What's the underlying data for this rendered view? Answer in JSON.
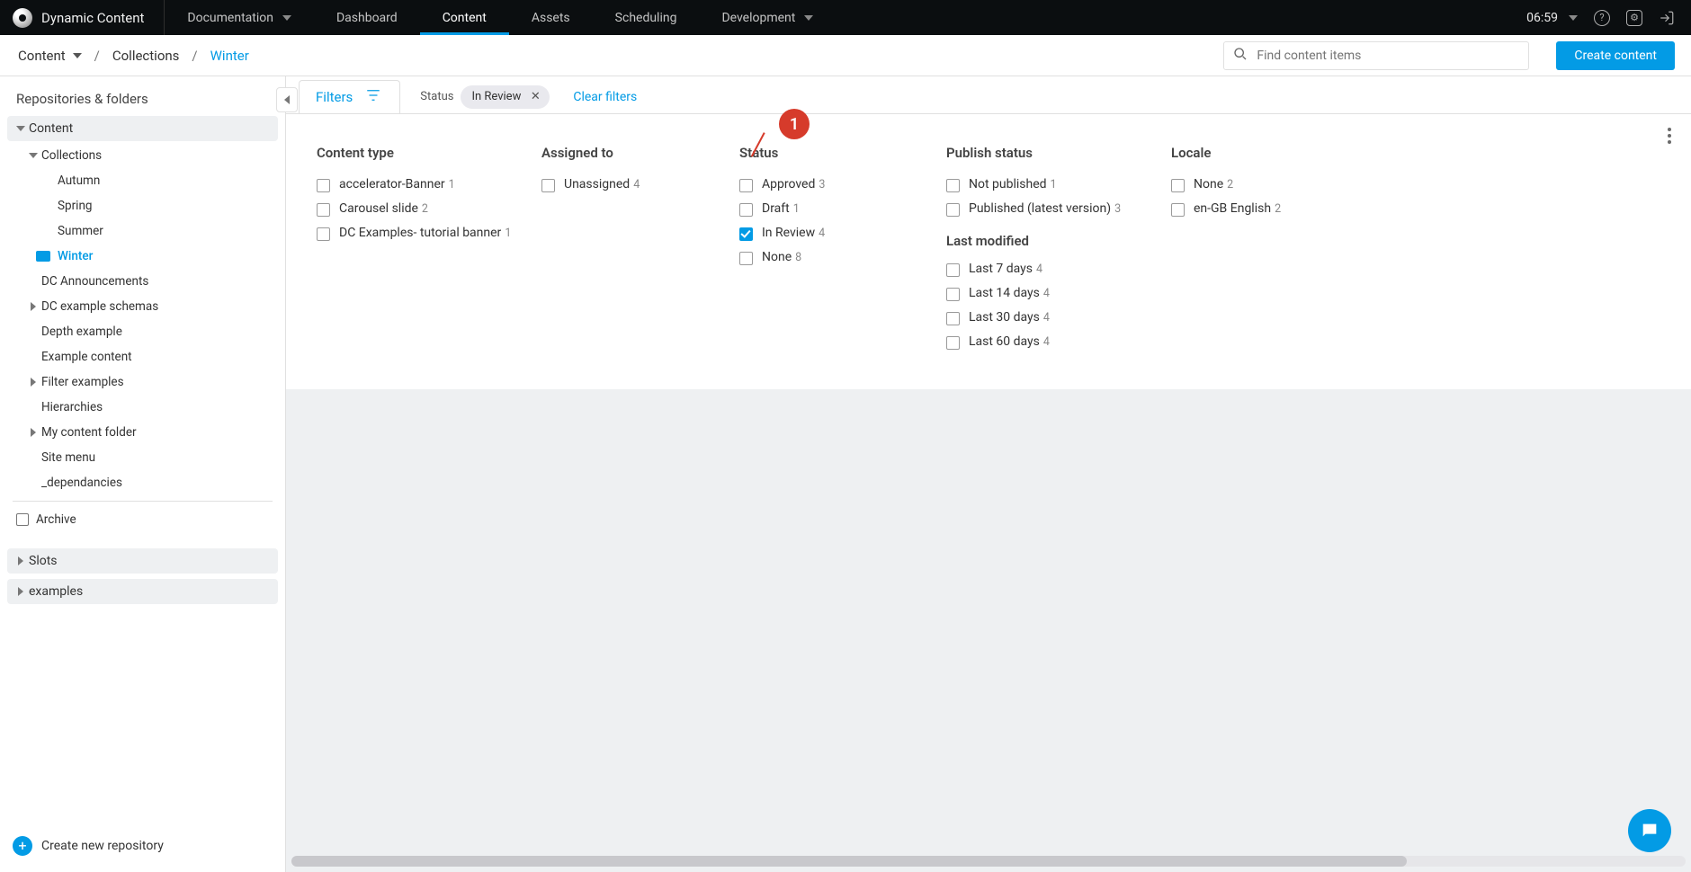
{
  "brand": {
    "name": "Dynamic Content"
  },
  "top_nav": {
    "items": [
      {
        "label": "Documentation",
        "dropdown": true,
        "active": false
      },
      {
        "label": "Dashboard",
        "dropdown": false,
        "active": false
      },
      {
        "label": "Content",
        "dropdown": false,
        "active": true
      },
      {
        "label": "Assets",
        "dropdown": false,
        "active": false
      },
      {
        "label": "Scheduling",
        "dropdown": false,
        "active": false
      },
      {
        "label": "Development",
        "dropdown": true,
        "active": false
      }
    ],
    "clock": "06:59"
  },
  "breadcrumb": {
    "root": "Content",
    "items": [
      "Collections",
      "Winter"
    ],
    "separator": "/"
  },
  "search": {
    "placeholder": "Find content items"
  },
  "create_button": {
    "label": "Create content"
  },
  "sidebar": {
    "title": "Repositories & folders",
    "sections": [
      {
        "label": "Content",
        "expanded": true,
        "children": [
          {
            "label": "Collections",
            "expanded": true,
            "children": [
              {
                "label": "Autumn"
              },
              {
                "label": "Spring"
              },
              {
                "label": "Summer"
              },
              {
                "label": "Winter",
                "selected": true
              }
            ]
          },
          {
            "label": "DC Announcements"
          },
          {
            "label": "DC example schemas",
            "expandable": true
          },
          {
            "label": "Depth example"
          },
          {
            "label": "Example content"
          },
          {
            "label": "Filter examples",
            "expandable": true
          },
          {
            "label": "Hierarchies"
          },
          {
            "label": "My content folder",
            "expandable": true
          },
          {
            "label": "Site menu"
          },
          {
            "label": "_dependancies"
          }
        ]
      },
      {
        "label": "Archive",
        "icon": "archive"
      },
      {
        "label": "Slots",
        "expandable": true
      },
      {
        "label": "examples",
        "expandable": true
      }
    ],
    "create_repo": "Create new repository"
  },
  "filters_bar": {
    "tab_label": "Filters",
    "status_label": "Status",
    "active_chip": {
      "label": "In Review"
    },
    "clear": "Clear filters"
  },
  "callout": {
    "badge": "1"
  },
  "filter_panel": {
    "columns": {
      "content_type": {
        "title": "Content type",
        "items": [
          {
            "label": "accelerator-Banner",
            "count": 1,
            "checked": false
          },
          {
            "label": "Carousel slide",
            "count": 2,
            "checked": false
          },
          {
            "label": "DC Examples- tutorial banner",
            "count": 1,
            "checked": false
          }
        ]
      },
      "assigned_to": {
        "title": "Assigned to",
        "items": [
          {
            "label": "Unassigned",
            "count": 4,
            "checked": false
          }
        ]
      },
      "status": {
        "title": "Status",
        "items": [
          {
            "label": "Approved",
            "count": 3,
            "checked": false
          },
          {
            "label": "Draft",
            "count": 1,
            "checked": false
          },
          {
            "label": "In Review",
            "count": 4,
            "checked": true
          },
          {
            "label": "None",
            "count": 8,
            "checked": false
          }
        ]
      },
      "publish_status": {
        "title": "Publish status",
        "items": [
          {
            "label": "Not published",
            "count": 1,
            "checked": false
          },
          {
            "label": "Published (latest version)",
            "count": 3,
            "checked": false
          }
        ]
      },
      "last_modified": {
        "title": "Last modified",
        "items": [
          {
            "label": "Last 7 days",
            "count": 4,
            "checked": false
          },
          {
            "label": "Last 14 days",
            "count": 4,
            "checked": false
          },
          {
            "label": "Last 30 days",
            "count": 4,
            "checked": false
          },
          {
            "label": "Last 60 days",
            "count": 4,
            "checked": false
          }
        ]
      },
      "locale": {
        "title": "Locale",
        "items": [
          {
            "label": "None",
            "count": 2,
            "checked": false
          },
          {
            "label": "en-GB English",
            "count": 2,
            "checked": false
          }
        ]
      }
    }
  }
}
